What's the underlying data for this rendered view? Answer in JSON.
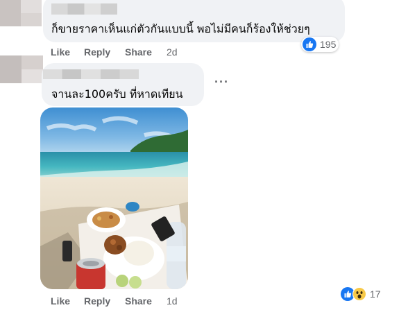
{
  "comments": [
    {
      "text": "ก็ขายราคาเห็นแก่ตัวกันแบบนี้ พอไม่มีคนก็ร้องให้ช่วยๆ",
      "actions": {
        "like": "Like",
        "reply": "Reply",
        "share": "Share",
        "time": "2d"
      },
      "reactions": {
        "icons": [
          "like-icon"
        ],
        "count": "195"
      }
    },
    {
      "text": "จานละ100ครับ ที่หาดเทียน",
      "actions": {
        "like": "Like",
        "reply": "Reply",
        "share": "Share",
        "time": "1d"
      },
      "reactions": {
        "icons": [
          "like-icon",
          "wow-icon"
        ],
        "count": "17"
      },
      "more_menu": "more-options-icon",
      "photo": "beach-food-photo"
    }
  ]
}
